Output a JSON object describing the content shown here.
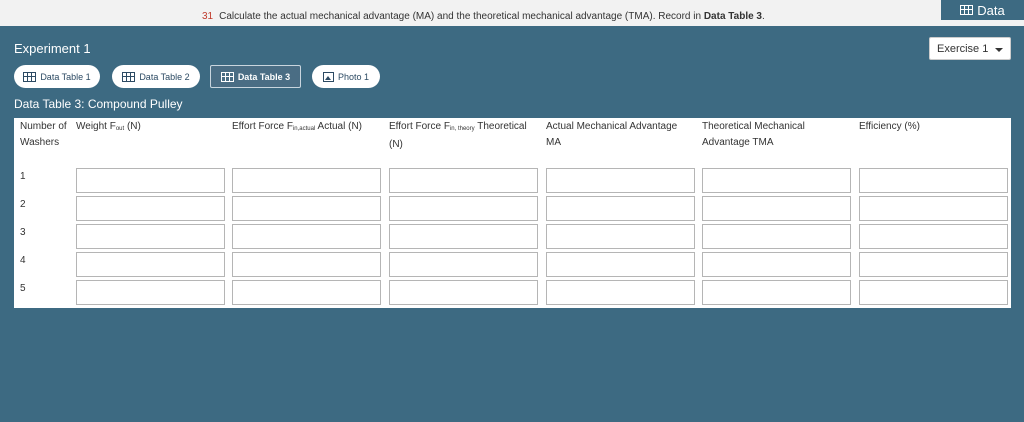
{
  "instruction": {
    "number": "31",
    "text_before": "Calculate the actual mechanical advantage (MA) and the theoretical mechanical advantage (TMA). Record in ",
    "bold": "Data Table 3",
    "text_after": "."
  },
  "data_button": {
    "label": "Data",
    "icon": "table-grid-icon"
  },
  "experiment_title": "Experiment 1",
  "exercise_select": {
    "value": "Exercise 1"
  },
  "tabs": [
    {
      "label": "Data Table 1",
      "icon": "table-grid-icon",
      "active": false
    },
    {
      "label": "Data Table 2",
      "icon": "table-grid-icon",
      "active": false
    },
    {
      "label": "Data Table 3",
      "icon": "table-grid-icon",
      "active": true
    },
    {
      "label": "Photo 1",
      "icon": "photo-icon",
      "active": false
    }
  ],
  "table": {
    "title": "Data Table 3: Compound Pulley",
    "headers": [
      {
        "pre": "Number of Washers",
        "sub": "",
        "post": ""
      },
      {
        "pre": "Weight F",
        "sub": "out",
        "post": " (N)"
      },
      {
        "pre": "Effort Force F",
        "sub": "in,actual",
        "post": " Actual (N)"
      },
      {
        "pre": "Effort Force F",
        "sub": "in, theory",
        "post": " Theoretical (N)"
      },
      {
        "pre": "Actual Mechanical Advantage MA",
        "sub": "",
        "post": ""
      },
      {
        "pre": "Theoretical Mechanical Advantage TMA",
        "sub": "",
        "post": ""
      },
      {
        "pre": "Efficiency (%)",
        "sub": "",
        "post": ""
      }
    ],
    "rows": [
      {
        "washers": "1",
        "values": [
          "",
          "",
          "",
          "",
          "",
          ""
        ]
      },
      {
        "washers": "2",
        "values": [
          "",
          "",
          "",
          "",
          "",
          ""
        ]
      },
      {
        "washers": "3",
        "values": [
          "",
          "",
          "",
          "",
          "",
          ""
        ]
      },
      {
        "washers": "4",
        "values": [
          "",
          "",
          "",
          "",
          "",
          ""
        ]
      },
      {
        "washers": "5",
        "values": [
          "",
          "",
          "",
          "",
          "",
          ""
        ]
      }
    ]
  }
}
